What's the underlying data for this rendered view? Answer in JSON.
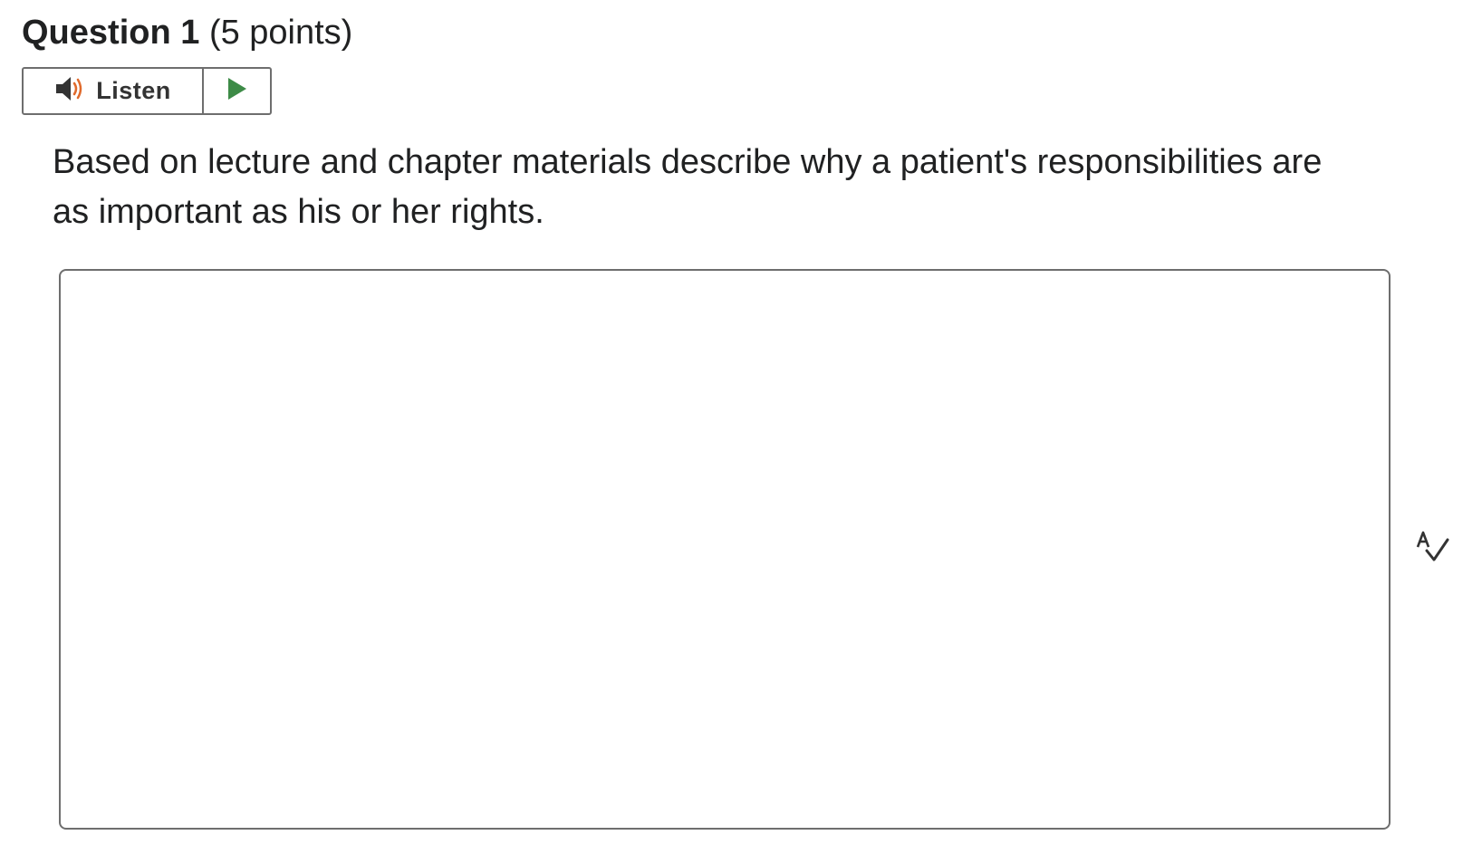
{
  "question": {
    "title": "Question 1",
    "points": "(5 points)",
    "prompt": "Based on lecture and chapter materials describe why a patient's responsibilities are as important as his or her rights."
  },
  "listen": {
    "label": "Listen",
    "speaker_icon": "speaker-icon",
    "play_icon": "play-icon"
  },
  "answer": {
    "value": "",
    "placeholder": ""
  },
  "tools": {
    "spellcheck_icon": "spellcheck-icon"
  },
  "colors": {
    "play_green": "#3d8b47",
    "speaker_orange": "#e06a2c",
    "border_gray": "#6e6e6e",
    "text": "#202122"
  }
}
